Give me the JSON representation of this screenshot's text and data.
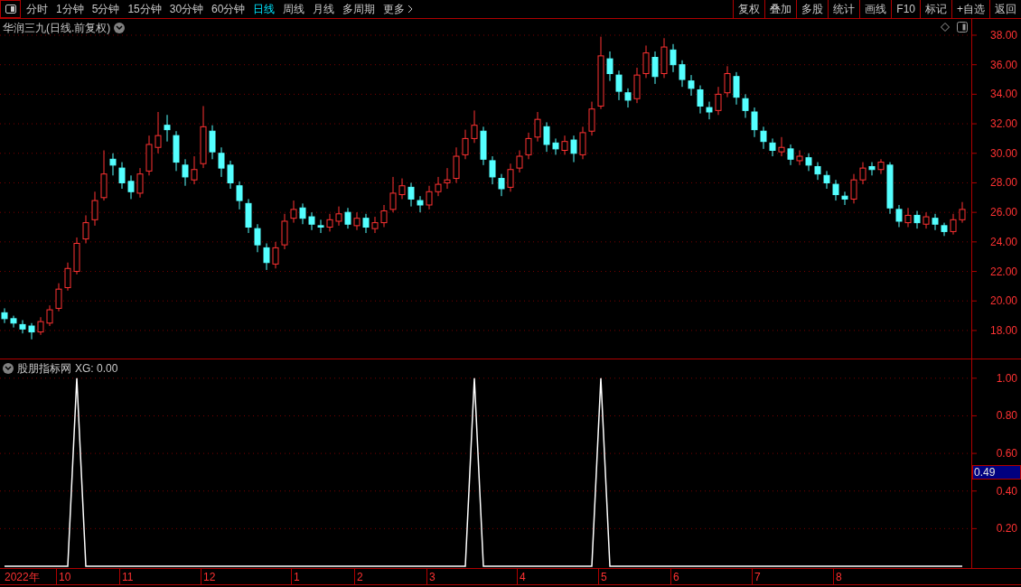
{
  "toolbar": {
    "periods": [
      {
        "label": "分时",
        "selected": false
      },
      {
        "label": "1分钟",
        "selected": false
      },
      {
        "label": "5分钟",
        "selected": false
      },
      {
        "label": "15分钟",
        "selected": false
      },
      {
        "label": "30分钟",
        "selected": false
      },
      {
        "label": "60分钟",
        "selected": false
      },
      {
        "label": "日线",
        "selected": true
      },
      {
        "label": "周线",
        "selected": false
      },
      {
        "label": "月线",
        "selected": false
      },
      {
        "label": "多周期",
        "selected": false
      }
    ],
    "more": "更多",
    "actions": [
      "复权",
      "叠加",
      "多股",
      "统计",
      "画线",
      "F10",
      "标记",
      "+自选",
      "返回"
    ]
  },
  "main_chart": {
    "title": "华润三九(日线.前复权)",
    "chart_data": {
      "type": "candlestick",
      "grid": true,
      "ylim": [
        16.1,
        39.1
      ],
      "yticks": [
        {
          "value": 38,
          "label": "38.00"
        },
        {
          "value": 36,
          "label": "36.00"
        },
        {
          "value": 34,
          "label": "34.00"
        },
        {
          "value": 32,
          "label": "32.00"
        },
        {
          "value": 30,
          "label": "30.00"
        },
        {
          "value": 28,
          "label": "28.00"
        },
        {
          "value": 26,
          "label": "26.00"
        },
        {
          "value": 24,
          "label": "24.00"
        },
        {
          "value": 22,
          "label": "22.00"
        },
        {
          "value": 20,
          "label": "20.00"
        },
        {
          "value": 18,
          "label": "18.00"
        }
      ],
      "ohlc": [
        [
          19.2,
          19.5,
          18.5,
          18.8
        ],
        [
          18.8,
          19.0,
          18.2,
          18.5
        ],
        [
          18.4,
          18.7,
          17.8,
          18.1
        ],
        [
          18.3,
          18.5,
          17.4,
          17.9
        ],
        [
          17.9,
          18.9,
          17.7,
          18.6
        ],
        [
          18.5,
          19.7,
          18.3,
          19.4
        ],
        [
          19.5,
          21.2,
          19.3,
          20.8
        ],
        [
          20.9,
          22.6,
          20.7,
          22.2
        ],
        [
          22.0,
          24.3,
          21.8,
          23.9
        ],
        [
          24.2,
          25.8,
          23.9,
          25.3
        ],
        [
          25.5,
          27.4,
          25.1,
          26.8
        ],
        [
          27.0,
          30.2,
          26.8,
          28.6
        ],
        [
          29.6,
          30.0,
          28.5,
          29.2
        ],
        [
          29.0,
          29.4,
          27.6,
          28.0
        ],
        [
          28.1,
          28.5,
          26.9,
          27.4
        ],
        [
          27.3,
          29.0,
          27.0,
          28.6
        ],
        [
          28.8,
          31.2,
          28.5,
          30.6
        ],
        [
          30.4,
          32.8,
          30.0,
          31.2
        ],
        [
          31.9,
          32.6,
          30.8,
          31.6
        ],
        [
          31.2,
          31.5,
          28.8,
          29.4
        ],
        [
          29.2,
          29.6,
          27.8,
          28.4
        ],
        [
          28.2,
          29.8,
          27.9,
          28.9
        ],
        [
          29.3,
          33.2,
          29.0,
          31.8
        ],
        [
          31.5,
          31.9,
          29.6,
          30.1
        ],
        [
          30.0,
          30.4,
          28.4,
          29.0
        ],
        [
          29.2,
          29.5,
          27.6,
          28.0
        ],
        [
          27.8,
          28.1,
          26.2,
          26.8
        ],
        [
          26.6,
          26.9,
          24.6,
          25.0
        ],
        [
          24.9,
          25.2,
          23.3,
          23.8
        ],
        [
          23.6,
          23.9,
          22.1,
          22.6
        ],
        [
          22.5,
          24.0,
          22.2,
          23.6
        ],
        [
          23.8,
          25.9,
          23.5,
          25.4
        ],
        [
          25.6,
          26.8,
          25.3,
          26.2
        ],
        [
          26.3,
          26.6,
          25.2,
          25.6
        ],
        [
          25.7,
          26.0,
          24.8,
          25.2
        ],
        [
          25.1,
          25.5,
          24.6,
          25.0
        ],
        [
          25.0,
          25.9,
          24.7,
          25.5
        ],
        [
          25.4,
          26.4,
          25.1,
          25.9
        ],
        [
          26.0,
          26.3,
          24.9,
          25.2
        ],
        [
          25.1,
          26.0,
          24.8,
          25.6
        ],
        [
          25.6,
          25.9,
          24.6,
          25.0
        ],
        [
          24.9,
          25.7,
          24.6,
          25.3
        ],
        [
          25.3,
          26.5,
          25.0,
          26.1
        ],
        [
          26.2,
          28.4,
          26.0,
          27.3
        ],
        [
          27.2,
          28.3,
          26.9,
          27.8
        ],
        [
          27.7,
          28.0,
          26.4,
          26.9
        ],
        [
          26.8,
          27.1,
          26.0,
          26.5
        ],
        [
          26.5,
          27.8,
          26.2,
          27.4
        ],
        [
          27.4,
          28.4,
          27.1,
          27.9
        ],
        [
          28.0,
          29.0,
          27.6,
          28.2
        ],
        [
          28.3,
          30.4,
          28.0,
          29.8
        ],
        [
          29.9,
          31.6,
          29.6,
          31.0
        ],
        [
          31.0,
          32.9,
          30.7,
          31.9
        ],
        [
          31.5,
          31.8,
          29.2,
          29.6
        ],
        [
          29.5,
          29.8,
          27.9,
          28.4
        ],
        [
          28.3,
          28.6,
          27.1,
          27.6
        ],
        [
          27.7,
          29.3,
          27.4,
          28.9
        ],
        [
          29.0,
          30.2,
          28.7,
          29.8
        ],
        [
          29.9,
          31.4,
          29.6,
          31.0
        ],
        [
          31.1,
          32.8,
          30.8,
          32.3
        ],
        [
          31.8,
          32.1,
          30.1,
          30.6
        ],
        [
          30.7,
          31.0,
          29.9,
          30.3
        ],
        [
          30.2,
          31.2,
          29.9,
          30.8
        ],
        [
          30.9,
          31.2,
          29.4,
          30.0
        ],
        [
          29.9,
          31.8,
          29.6,
          31.4
        ],
        [
          31.5,
          33.5,
          31.2,
          33.0
        ],
        [
          33.2,
          37.9,
          33.0,
          36.6
        ],
        [
          36.4,
          36.9,
          34.9,
          35.4
        ],
        [
          35.3,
          35.6,
          33.6,
          34.2
        ],
        [
          34.1,
          34.4,
          33.1,
          33.6
        ],
        [
          33.7,
          35.8,
          33.4,
          35.3
        ],
        [
          35.4,
          37.3,
          35.1,
          36.8
        ],
        [
          36.5,
          36.9,
          34.7,
          35.2
        ],
        [
          35.4,
          37.8,
          35.1,
          37.2
        ],
        [
          37.0,
          37.4,
          35.5,
          36.0
        ],
        [
          36.0,
          36.3,
          34.5,
          35.0
        ],
        [
          34.9,
          35.3,
          33.9,
          34.4
        ],
        [
          34.3,
          34.6,
          32.7,
          33.2
        ],
        [
          33.1,
          33.5,
          32.3,
          32.8
        ],
        [
          32.9,
          34.5,
          32.6,
          34.0
        ],
        [
          34.1,
          35.9,
          33.8,
          35.4
        ],
        [
          35.2,
          35.5,
          33.3,
          33.8
        ],
        [
          33.7,
          34.0,
          32.4,
          32.9
        ],
        [
          32.8,
          33.1,
          31.1,
          31.6
        ],
        [
          31.5,
          31.8,
          30.3,
          30.8
        ],
        [
          30.7,
          31.0,
          29.8,
          30.2
        ],
        [
          30.1,
          31.1,
          29.8,
          30.4
        ],
        [
          30.3,
          30.6,
          29.2,
          29.6
        ],
        [
          29.5,
          30.2,
          29.2,
          29.8
        ],
        [
          29.7,
          30.0,
          28.8,
          29.2
        ],
        [
          29.1,
          29.4,
          28.2,
          28.6
        ],
        [
          28.5,
          28.8,
          27.6,
          28.0
        ],
        [
          27.9,
          28.2,
          26.8,
          27.2
        ],
        [
          27.1,
          27.4,
          26.5,
          26.9
        ],
        [
          26.9,
          28.6,
          26.6,
          28.2
        ],
        [
          28.2,
          29.4,
          27.9,
          29.0
        ],
        [
          29.1,
          29.4,
          28.5,
          28.9
        ],
        [
          28.9,
          29.6,
          28.6,
          29.4
        ],
        [
          29.2,
          29.4,
          25.9,
          26.3
        ],
        [
          26.2,
          26.5,
          25.0,
          25.4
        ],
        [
          25.3,
          26.3,
          25.0,
          25.8
        ],
        [
          25.8,
          26.1,
          24.9,
          25.3
        ],
        [
          25.2,
          26.0,
          24.9,
          25.7
        ],
        [
          25.6,
          25.9,
          24.8,
          25.2
        ],
        [
          25.1,
          25.3,
          24.4,
          24.7
        ],
        [
          24.7,
          25.9,
          24.5,
          25.5
        ],
        [
          25.5,
          26.7,
          25.3,
          26.2
        ]
      ]
    }
  },
  "indicator": {
    "title": "股朋指标网",
    "reading": ": 0.00",
    "cursor_value": "0.49",
    "chart_data": {
      "type": "line",
      "grid": true,
      "ylim": [
        0,
        1.1
      ],
      "yticks": [
        {
          "value": 1,
          "label": "1.00"
        },
        {
          "value": 0.8,
          "label": "0.80"
        },
        {
          "value": 0.6,
          "label": "0.60"
        },
        {
          "value": 0.4,
          "label": "0.40"
        },
        {
          "value": 0.2,
          "label": "0.20"
        }
      ],
      "series": [
        {
          "name": "XG",
          "color": "#ffffff",
          "values": [
            0,
            0,
            0,
            0,
            0,
            0,
            0,
            0,
            1,
            0,
            0,
            0,
            0,
            0,
            0,
            0,
            0,
            0,
            0,
            0,
            0,
            0,
            0,
            0,
            0,
            0,
            0,
            0,
            0,
            0,
            0,
            0,
            0,
            0,
            0,
            0,
            0,
            0,
            0,
            0,
            0,
            0,
            0,
            0,
            0,
            0,
            0,
            0,
            0,
            0,
            0,
            0,
            1,
            0,
            0,
            0,
            0,
            0,
            0,
            0,
            0,
            0,
            0,
            0,
            0,
            0,
            1,
            0,
            0,
            0,
            0,
            0,
            0,
            0,
            0,
            0,
            0,
            0,
            0,
            0,
            0,
            0,
            0,
            0,
            0,
            0,
            0,
            0,
            0,
            0,
            0,
            0,
            0,
            0,
            0,
            0,
            0,
            0,
            0,
            0,
            0,
            0,
            0,
            0,
            0,
            0,
            0
          ]
        }
      ]
    }
  },
  "x_axis": {
    "labels": [
      "2022年",
      "10",
      "11",
      "12",
      "1",
      "2",
      "3",
      "4",
      "5",
      "6",
      "7",
      "8"
    ]
  }
}
